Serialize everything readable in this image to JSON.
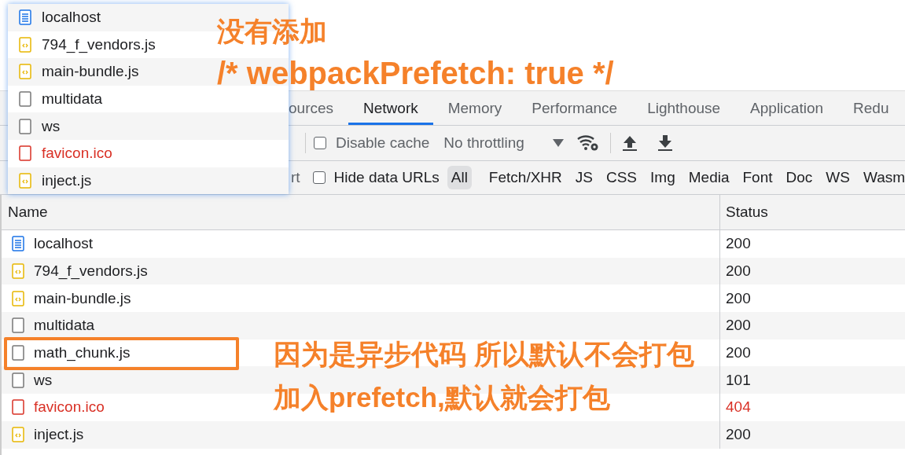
{
  "request_popup": {
    "items": [
      {
        "name": "localhost",
        "kind": "doc",
        "failed": false
      },
      {
        "name": "794_f_vendors.js",
        "kind": "script",
        "failed": false
      },
      {
        "name": "main-bundle.js",
        "kind": "script",
        "failed": false
      },
      {
        "name": "multidata",
        "kind": "plain",
        "failed": false
      },
      {
        "name": "ws",
        "kind": "plain",
        "failed": false
      },
      {
        "name": "favicon.ico",
        "kind": "plain",
        "failed": true
      },
      {
        "name": "inject.js",
        "kind": "script",
        "failed": false
      }
    ]
  },
  "tabs": [
    {
      "label": "ources",
      "selected": false
    },
    {
      "label": "Network",
      "selected": true
    },
    {
      "label": "Memory",
      "selected": false
    },
    {
      "label": "Performance",
      "selected": false
    },
    {
      "label": "Lighthouse",
      "selected": false
    },
    {
      "label": "Application",
      "selected": false
    },
    {
      "label": "Redu",
      "selected": false
    }
  ],
  "toolbar": {
    "disable_cache": {
      "label": "Disable cache",
      "checked": false
    },
    "throttling": "No throttling"
  },
  "filter_bar": {
    "cut_label": "rt",
    "hide_data_urls": {
      "label": "Hide data URLs",
      "checked": false
    },
    "types": [
      {
        "label": "All",
        "selected": true
      },
      {
        "label": "Fetch/XHR",
        "selected": false
      },
      {
        "label": "JS",
        "selected": false
      },
      {
        "label": "CSS",
        "selected": false
      },
      {
        "label": "Img",
        "selected": false
      },
      {
        "label": "Media",
        "selected": false
      },
      {
        "label": "Font",
        "selected": false
      },
      {
        "label": "Doc",
        "selected": false
      },
      {
        "label": "WS",
        "selected": false
      },
      {
        "label": "Wasm",
        "selected": false
      }
    ]
  },
  "table": {
    "columns": [
      "Name",
      "Status"
    ],
    "rows": [
      {
        "name": "localhost",
        "kind": "doc",
        "failed": false,
        "status": "200",
        "highlighted": false
      },
      {
        "name": "794_f_vendors.js",
        "kind": "script",
        "failed": false,
        "status": "200",
        "highlighted": false
      },
      {
        "name": "main-bundle.js",
        "kind": "script",
        "failed": false,
        "status": "200",
        "highlighted": false
      },
      {
        "name": "multidata",
        "kind": "plain",
        "failed": false,
        "status": "200",
        "highlighted": false
      },
      {
        "name": "math_chunk.js",
        "kind": "plain",
        "failed": false,
        "status": "200",
        "highlighted": true
      },
      {
        "name": "ws",
        "kind": "plain",
        "failed": false,
        "status": "101",
        "highlighted": false
      },
      {
        "name": "favicon.ico",
        "kind": "plain",
        "failed": true,
        "status": "404",
        "highlighted": false
      },
      {
        "name": "inject.js",
        "kind": "script",
        "failed": false,
        "status": "200",
        "highlighted": false
      }
    ]
  },
  "annotations": {
    "top": [
      "没有添加",
      "/* webpackPrefetch: true */"
    ],
    "side": [
      "因为是异步代码 所以默认不会打包",
      "加入prefetch,默认就会打包"
    ]
  }
}
